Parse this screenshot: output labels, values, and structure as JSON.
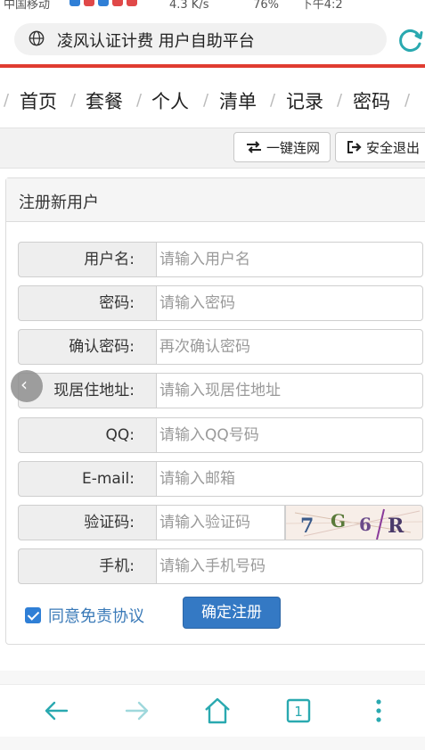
{
  "status_bar": {
    "carrier": "中国移动",
    "speed": "4.3 K/s",
    "battery": "76%",
    "time": "下午4:2"
  },
  "browser": {
    "address_text": "凌风认证计费 用户自助平台",
    "icons": [
      "globe-icon",
      "reload-icon"
    ]
  },
  "nav": {
    "items": [
      "首页",
      "套餐",
      "个人",
      "清单",
      "记录",
      "密码"
    ]
  },
  "toolbar": {
    "connect_label": "一键连网",
    "logout_label": "安全退出"
  },
  "form": {
    "title": "注册新用户",
    "fields": [
      {
        "label": "用户名:",
        "placeholder": "请输入用户名"
      },
      {
        "label": "密码:",
        "placeholder": "请输入密码"
      },
      {
        "label": "确认密码:",
        "placeholder": "再次确认密码"
      },
      {
        "label": "现居住地址:",
        "placeholder": "请输入现居住地址"
      },
      {
        "label": "QQ:",
        "placeholder": "请输入QQ号码"
      },
      {
        "label": "E-mail:",
        "placeholder": "请输入邮箱"
      },
      {
        "label": "验证码:",
        "placeholder": "请输入验证码"
      },
      {
        "label": "手机:",
        "placeholder": "请输入手机号码"
      }
    ],
    "captcha_text": "7G6R",
    "agree_label": "同意免责协议",
    "agree_checked": true,
    "submit_label": "确定注册"
  },
  "colors": {
    "accent_red": "#e03c31",
    "primary_button": "#3479c4",
    "nav_icon_teal": "#2aa9b0",
    "link_blue": "#3a7ab8"
  },
  "bottom_bar": {
    "icons": [
      "back-arrow-icon",
      "forward-arrow-icon",
      "home-icon",
      "tabs-icon",
      "more-icon"
    ],
    "tab_count": "1"
  }
}
